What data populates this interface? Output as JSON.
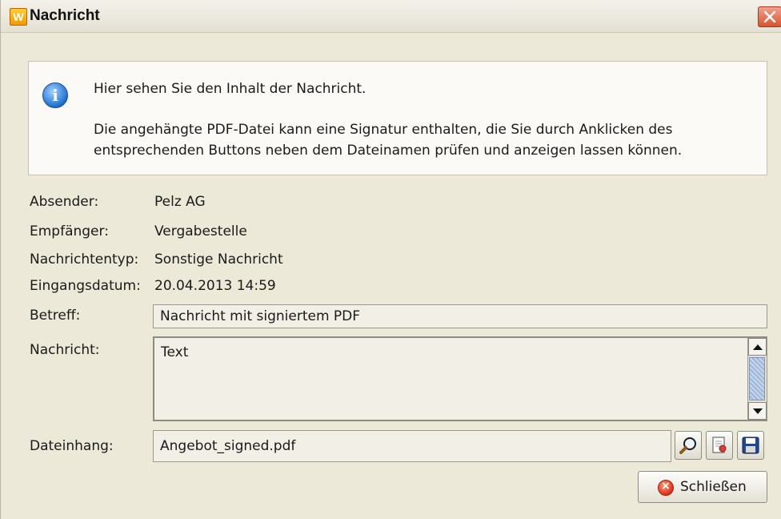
{
  "window": {
    "title": "Nachricht",
    "app_icon_text": "W"
  },
  "info": {
    "icon": "info-icon",
    "line1": "Hier sehen Sie den Inhalt der Nachricht.",
    "line2": "Die angehängte PDF-Datei kann eine Signatur enthalten, die Sie durch Anklicken des entsprechenden Buttons neben dem Dateinamen prüfen und anzeigen lassen können."
  },
  "fields": {
    "sender_label": "Absender:",
    "sender_value": "Pelz AG",
    "recipient_label": "Empfänger:",
    "recipient_value": "Vergabestelle",
    "type_label": "Nachrichtentyp:",
    "type_value": "Sonstige Nachricht",
    "date_label": "Eingangsdatum:",
    "date_value": "20.04.2013 14:59",
    "subject_label": "Betreff:",
    "subject_value": "Nachricht mit signiertem PDF",
    "message_label": "Nachricht:",
    "message_value": "Text",
    "attachment_label": "Dateinhang:",
    "attachment_value": "Angebot_signed.pdf"
  },
  "buttons": {
    "close_label": "Schließen"
  },
  "colors": {
    "dialog_bg": "#ece9d8",
    "close_red": "#d9532f",
    "info_blue": "#1f6fd1"
  }
}
